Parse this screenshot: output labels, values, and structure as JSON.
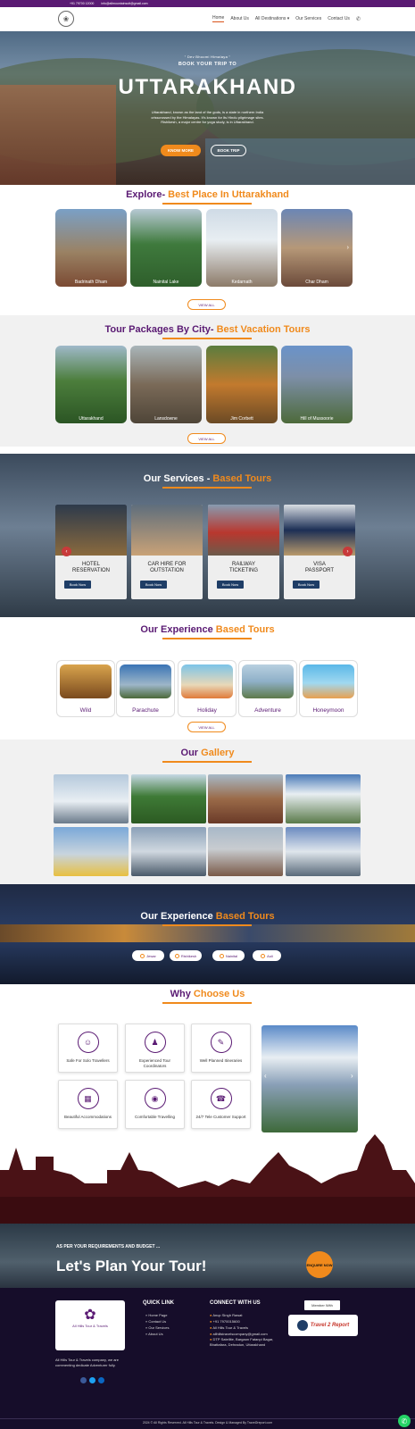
{
  "topbar": {
    "phone": "+91 79700 12000",
    "email": "info@allmountainsutt@gmail.com"
  },
  "nav": {
    "items": [
      "Home",
      "About Us",
      "All Destinations",
      "Our Services",
      "Contact Us"
    ]
  },
  "hero": {
    "tagline": "\" Dev Bhoomi Himalaya \"",
    "subtitle": "BOOK YOUR TRIP TO",
    "title": "UTTARAKHAND",
    "description": "Uttarakhand, known as the land of the gods, is a state in northern India crisscrossed by the Himalayas. It's known for its Hindu pilgrimage sites. Rishikesh, a major centre for yoga study, is in Uttarakhand.",
    "btn_primary": "KNOW MORE",
    "btn_secondary": "BOOK TRIP"
  },
  "explore": {
    "title": "Explore-",
    "title_hl": " Best Place In Uttarakhand",
    "cards": [
      "Badrinath Dham",
      "Nainital Lake",
      "Kedarnath",
      "Char Dham"
    ],
    "view_all": "VIEW ALL"
  },
  "packages": {
    "title": "Tour Packages By City-",
    "title_hl": " Best Vacation Tours",
    "cards": [
      "Uttarakhand",
      "Lansdowne",
      "Jim Corbett",
      "Hill of Mussoorie"
    ],
    "view_all": "VIEW ALL"
  },
  "services": {
    "title": "Our Services - ",
    "title_hl": "Based Tours",
    "cards": [
      {
        "line1": "HOTEL",
        "line2": "RESERVATION",
        "btn": "Book Now"
      },
      {
        "line1": "CAR HIRE FOR",
        "line2": "OUTSTATION",
        "btn": "Book Now"
      },
      {
        "line1": "RAILWAY",
        "line2": "TICKETING",
        "btn": "Book Now"
      },
      {
        "line1": "VISA",
        "line2": "PASSPORT",
        "btn": "Book Now"
      }
    ]
  },
  "experience": {
    "title": "Our Experience ",
    "title_hl": "Based Tours",
    "cards": [
      "Wild",
      "Parachute",
      "Holiday",
      "Adventure",
      "Honeymoon"
    ],
    "view_all": "VIEW ALL"
  },
  "gallery": {
    "title": "Our ",
    "title_hl": "Gallery"
  },
  "experience2": {
    "title": "Our Experience ",
    "title_hl": "Based Tours",
    "pills": [
      "Jewar",
      "Rishikesh",
      "Nainital",
      "Auli"
    ]
  },
  "why": {
    "title": "Why ",
    "title_hl": "Choose Us",
    "cards": [
      "Safe For Solo Travellers",
      "Experienced Tour Coordinators",
      "Well Planned Itineraries",
      "Beautiful Accommodations",
      "Comfortable Travelling",
      "24/7 Tele Customer Support"
    ]
  },
  "plan": {
    "kicker": "AS PER YOUR REQUIREMENTS AND BUDGET ...",
    "title": "Let's Plan Your Tour!",
    "btn": "ENQUIRE NOW"
  },
  "footer": {
    "logo_text": "All Hills Tour & Travels",
    "about": "All Hills Tour & Travels company, we are commenting dedicate Adventurer fully.",
    "quick_title": "QUICK LINK",
    "quick_links": [
      "» Home Page",
      "» Contact Us",
      "» Our Services",
      "» About Us"
    ],
    "connect_title": "CONNECT WITH US",
    "connect": [
      "Anup Singh Rawat",
      "+91 7970015600",
      "All Hills Tour & Travels",
      "allhillstravelscompany@gmail.com",
      "DTP Satellite, Bargaon Fatanpi Bagar, Bhattafara, Dehradun, Uttarakhand"
    ],
    "member_label": "Member With",
    "partner": "Travel 2 Report",
    "copyright": "2024 © All Rights Reserved. All Hills Tour & Travels. Design & Managed By Travel2report.com"
  }
}
